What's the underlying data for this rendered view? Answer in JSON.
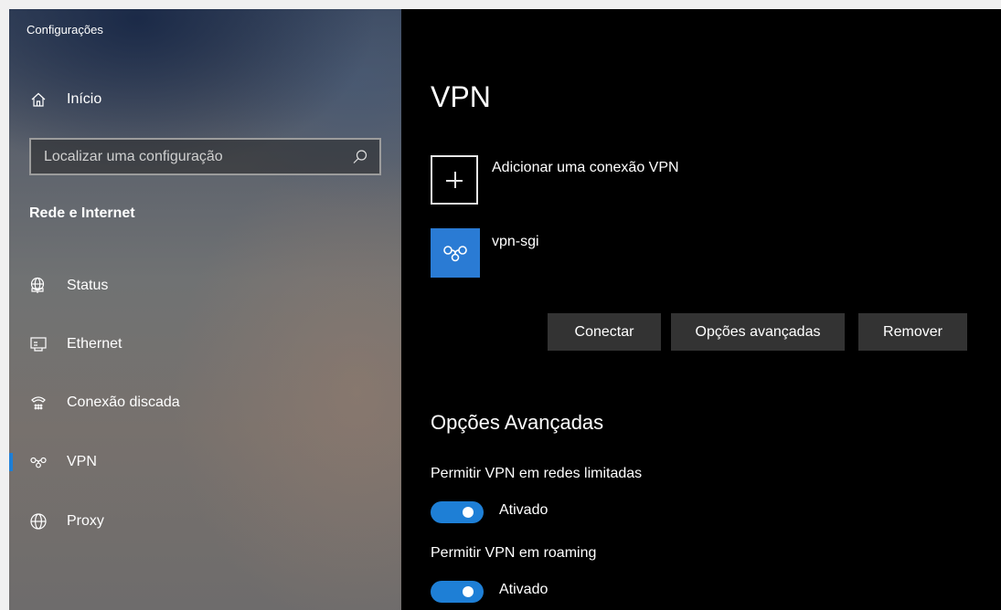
{
  "window": {
    "title": "Configurações"
  },
  "sidebar": {
    "home_label": "Início",
    "search_placeholder": "Localizar uma configuração",
    "section_title": "Rede e Internet",
    "items": [
      {
        "label": "Status",
        "icon": "globe-monitor-icon"
      },
      {
        "label": "Ethernet",
        "icon": "ethernet-icon"
      },
      {
        "label": "Conexão discada",
        "icon": "dialup-icon"
      },
      {
        "label": "VPN",
        "icon": "vpn-icon",
        "selected": true
      },
      {
        "label": "Proxy",
        "icon": "globe-icon"
      }
    ]
  },
  "main": {
    "title": "VPN",
    "add_connection_label": "Adicionar uma conexão VPN",
    "connection": {
      "name": "vpn-sgi"
    },
    "buttons": {
      "connect": "Conectar",
      "advanced": "Opções avançadas",
      "remove": "Remover"
    },
    "advanced_section": {
      "title": "Opções Avançadas",
      "options": [
        {
          "label": "Permitir VPN em redes limitadas",
          "state": "Ativado",
          "on": true
        },
        {
          "label": "Permitir VPN em roaming",
          "state": "Ativado",
          "on": true
        }
      ]
    }
  },
  "colors": {
    "accent": "#1e7fd6",
    "vpn_tile": "#2a7bd4",
    "button_bg": "#333333"
  }
}
